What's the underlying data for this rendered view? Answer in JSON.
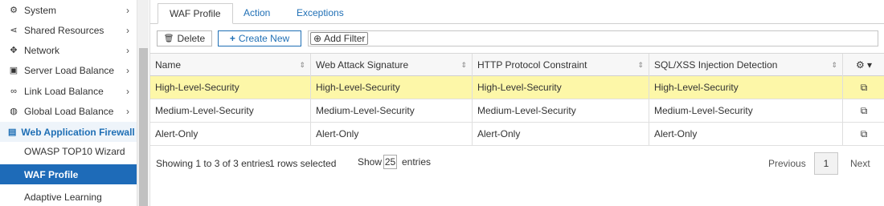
{
  "sidebar": {
    "items": [
      {
        "label": "System",
        "icon": "gear-icon",
        "glyph": "⚙",
        "chev": "›"
      },
      {
        "label": "Shared Resources",
        "icon": "share-icon",
        "glyph": "⋖",
        "chev": "›"
      },
      {
        "label": "Network",
        "icon": "network-icon",
        "glyph": "✥",
        "chev": "›"
      },
      {
        "label": "Server Load Balance",
        "icon": "server-lb-icon",
        "glyph": "▣",
        "chev": "›"
      },
      {
        "label": "Link Load Balance",
        "icon": "link-icon",
        "glyph": "∞",
        "chev": "›"
      },
      {
        "label": "Global Load Balance",
        "icon": "globe-icon",
        "glyph": "◍",
        "chev": "›"
      },
      {
        "label": "Web Application Firewall",
        "icon": "waf-icon",
        "glyph": "▤",
        "chev": "⌄"
      }
    ],
    "subitems": [
      "OWASP TOP10 Wizard",
      "WAF Profile",
      "Adaptive Learning"
    ]
  },
  "tabs": [
    "WAF Profile",
    "Action",
    "Exceptions"
  ],
  "toolbar": {
    "delete_label": "Delete",
    "delete_icon": "🗑",
    "create_label": "Create New",
    "create_icon": "+",
    "filter_label": "Add Filter",
    "filter_icon": "⊕"
  },
  "table": {
    "columns": [
      "Name",
      "Web Attack Signature",
      "HTTP Protocol Constraint",
      "SQL/XSS Injection Detection"
    ],
    "settings_icon": "⚙ ▾",
    "sort_icon": "⇕",
    "clone_icon": "⧉",
    "rows": [
      [
        "High-Level-Security",
        "High-Level-Security",
        "High-Level-Security",
        "High-Level-Security"
      ],
      [
        "Medium-Level-Security",
        "Medium-Level-Security",
        "Medium-Level-Security",
        "Medium-Level-Security"
      ],
      [
        "Alert-Only",
        "Alert-Only",
        "Alert-Only",
        "Alert-Only"
      ]
    ]
  },
  "footer": {
    "entries_info": "Showing 1 to 3 of 3 entries",
    "selected_info": "1 rows selected",
    "show_label": "Show",
    "show_value": "25",
    "entries_label": "entries",
    "prev": "Previous",
    "page": "1",
    "next": "Next"
  },
  "colors": {
    "accent": "#1e6bb8",
    "selected_row": "#fdf7a8"
  }
}
